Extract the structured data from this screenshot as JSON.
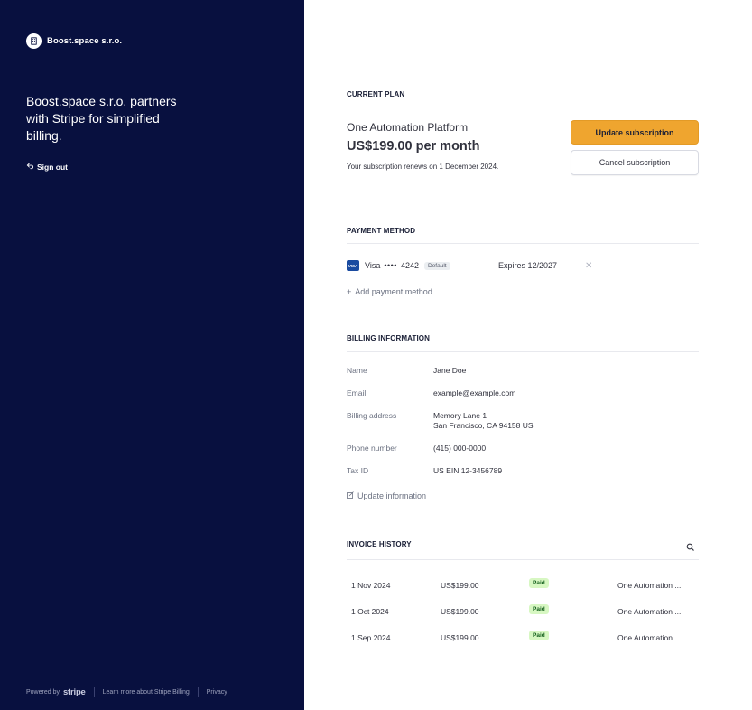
{
  "brand": {
    "name": "Boost.space s.r.o.",
    "tagline": "Boost.space s.r.o. partners with Stripe for simplified billing.",
    "sign_out": "Sign out"
  },
  "footer": {
    "powered_by": "Powered by",
    "stripe": "stripe",
    "learn_more": "Learn more about Stripe Billing",
    "privacy": "Privacy"
  },
  "current_plan": {
    "title": "CURRENT PLAN",
    "plan_name": "One Automation Platform",
    "price": "US$199.00 per month",
    "renewal": "Your subscription renews on 1 December 2024.",
    "update_button": "Update subscription",
    "cancel_button": "Cancel subscription"
  },
  "payment_method": {
    "title": "PAYMENT METHOD",
    "card": {
      "brand_icon": "VISA",
      "brand": "Visa",
      "dots": "••••",
      "last4": "4242",
      "badge": "Default",
      "expires": "Expires 12/2027"
    },
    "add_label": "Add payment method"
  },
  "billing_information": {
    "title": "BILLING INFORMATION",
    "fields": [
      {
        "label": "Name",
        "value": "Jane Doe"
      },
      {
        "label": "Email",
        "value": "example@example.com"
      },
      {
        "label": "Billing address",
        "value": "Memory Lane 1",
        "value2": "San Francisco, CA 94158 US"
      },
      {
        "label": "Phone number",
        "value": "(415) 000-0000"
      },
      {
        "label": "Tax ID",
        "value": "US EIN 12-3456789"
      }
    ],
    "update_label": "Update information"
  },
  "invoice_history": {
    "title": "INVOICE HISTORY",
    "rows": [
      {
        "date": "1 Nov 2024",
        "amount": "US$199.00",
        "status": "Paid",
        "description": "One Automation ..."
      },
      {
        "date": "1 Oct 2024",
        "amount": "US$199.00",
        "status": "Paid",
        "description": "One Automation ..."
      },
      {
        "date": "1 Sep 2024",
        "amount": "US$199.00",
        "status": "Paid",
        "description": "One Automation ..."
      }
    ]
  },
  "colors": {
    "sidebar_bg": "#08103f",
    "accent": "#efa52f",
    "paid_bg": "#d7f7c2",
    "paid_text": "#15601e"
  },
  "icons": [
    "building-icon",
    "sign-out-icon",
    "visa-icon",
    "close-icon",
    "plus-icon",
    "edit-icon",
    "search-icon"
  ]
}
